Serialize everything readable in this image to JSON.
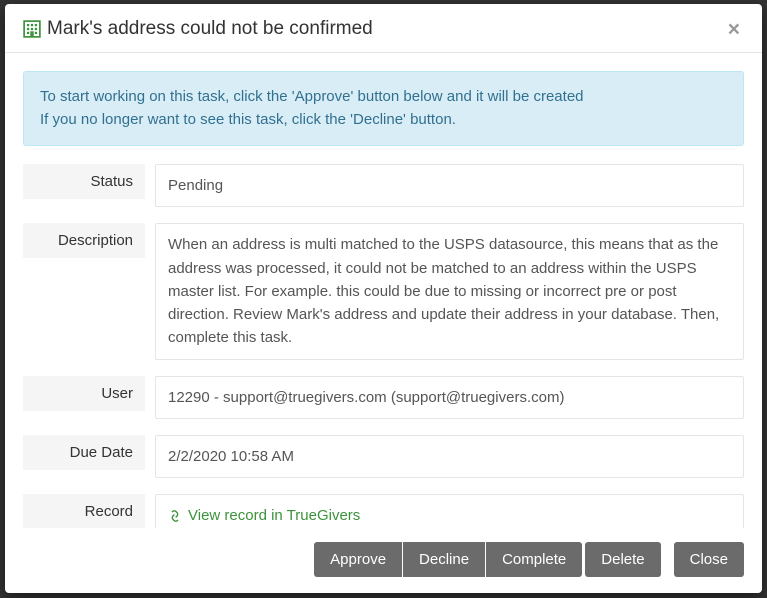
{
  "modal": {
    "title": "Mark's address could not be confirmed",
    "alert_line1": "To start working on this task, click the 'Approve' button below and it will be created",
    "alert_line2": "If you no longer want to see this task, click the 'Decline' button."
  },
  "fields": {
    "status": {
      "label": "Status",
      "value": "Pending"
    },
    "description": {
      "label": "Description",
      "value": "When an address is multi matched to the USPS datasource, this means that as the address was processed, it could not be matched to an address within the USPS master list. For example. this could be due to missing or incorrect pre or post direction. Review Mark's address and update their address in your database. Then, complete this task."
    },
    "user": {
      "label": "User",
      "value": "12290 - support@truegivers.com (support@truegivers.com)"
    },
    "due_date": {
      "label": "Due Date",
      "value": "2/2/2020 10:58 AM"
    },
    "record": {
      "label": "Record",
      "link_text": "View record in TrueGivers"
    }
  },
  "buttons": {
    "approve": "Approve",
    "decline": "Decline",
    "complete": "Complete",
    "delete": "Delete",
    "close": "Close"
  }
}
